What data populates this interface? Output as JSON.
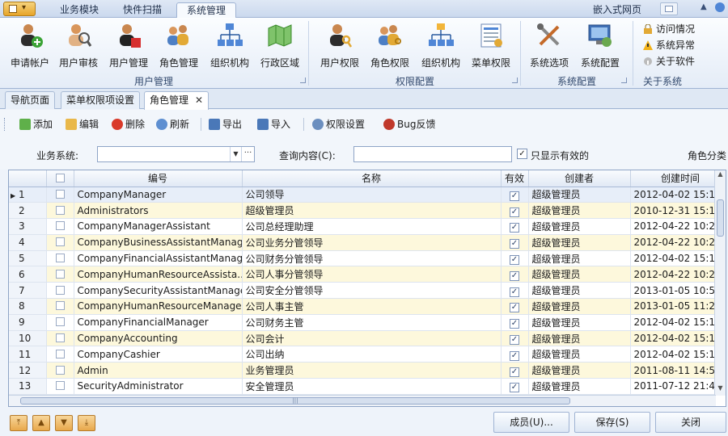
{
  "app": {
    "menu_tabs": [
      "业务模块",
      "快件扫描",
      "系统管理"
    ],
    "embed_label": "嵌入式网页"
  },
  "ribbon": {
    "groups": [
      {
        "label": "用户管理",
        "buttons": [
          "申请帐户",
          "用户审核",
          "用户管理",
          "角色管理",
          "组织机构",
          "行政区域"
        ]
      },
      {
        "label": "权限配置",
        "buttons": [
          "用户权限",
          "角色权限",
          "组织机构",
          "菜单权限"
        ]
      },
      {
        "label": "系统配置",
        "buttons": [
          "系统选项",
          "系统配置"
        ]
      },
      {
        "label": "关于系统",
        "small_items": [
          "访问情况",
          "系统异常",
          "关于软件"
        ]
      }
    ]
  },
  "doc_tabs": [
    "导航页面",
    "菜单权限项设置",
    "角色管理"
  ],
  "toolbar": {
    "items": [
      "添加",
      "编辑",
      "删除",
      "刷新",
      "导出",
      "导入",
      "权限设置",
      "Bug反馈"
    ]
  },
  "search": {
    "business_label": "业务系统:",
    "business_value": "",
    "query_label": "查询内容(C):",
    "query_value": "",
    "only_valid_label": "只显示有效的",
    "only_valid_checked": true,
    "category_label": "角色分类"
  },
  "grid": {
    "columns": [
      "",
      "",
      "编号",
      "名称",
      "有效",
      "创建者",
      "创建时间"
    ],
    "rows": [
      {
        "n": "1",
        "code": "CompanyManager",
        "name": "公司领导",
        "valid": true,
        "creator": "超级管理员",
        "time": "2012-04-02 15:1"
      },
      {
        "n": "2",
        "code": "Administrators",
        "name": "超级管理员",
        "valid": true,
        "creator": "超级管理员",
        "time": "2010-12-31 15:1"
      },
      {
        "n": "3",
        "code": "CompanyManagerAssistant",
        "name": "公司总经理助理",
        "valid": true,
        "creator": "超级管理员",
        "time": "2012-04-22 10:2"
      },
      {
        "n": "4",
        "code": "CompanyBusinessAssistantManager",
        "name": "公司业务分管领导",
        "valid": true,
        "creator": "超级管理员",
        "time": "2012-04-22 10:2"
      },
      {
        "n": "5",
        "code": "CompanyFinancialAssistantManager",
        "name": "公司财务分管领导",
        "valid": true,
        "creator": "超级管理员",
        "time": "2012-04-02 15:1"
      },
      {
        "n": "6",
        "code": "CompanyHumanResourceAssista...",
        "name": "公司人事分管领导",
        "valid": true,
        "creator": "超级管理员",
        "time": "2012-04-22 10:2"
      },
      {
        "n": "7",
        "code": "CompanySecurityAssistantManager",
        "name": "公司安全分管领导",
        "valid": true,
        "creator": "超级管理员",
        "time": "2013-01-05 10:5"
      },
      {
        "n": "8",
        "code": "CompanyHumanResourceManager",
        "name": "公司人事主管",
        "valid": true,
        "creator": "超级管理员",
        "time": "2013-01-05 11:2"
      },
      {
        "n": "9",
        "code": "CompanyFinancialManager",
        "name": "公司财务主管",
        "valid": true,
        "creator": "超级管理员",
        "time": "2012-04-02 15:1"
      },
      {
        "n": "10",
        "code": "CompanyAccounting",
        "name": "公司会计",
        "valid": true,
        "creator": "超级管理员",
        "time": "2012-04-02 15:1"
      },
      {
        "n": "11",
        "code": "CompanyCashier",
        "name": "公司出纳",
        "valid": true,
        "creator": "超级管理员",
        "time": "2012-04-02 15:1"
      },
      {
        "n": "12",
        "code": "Admin",
        "name": "业务管理员",
        "valid": true,
        "creator": "超级管理员",
        "time": "2011-08-11 14:5"
      },
      {
        "n": "13",
        "code": "SecurityAdministrator",
        "name": "安全管理员",
        "valid": true,
        "creator": "超级管理员",
        "time": "2011-07-12 21:4"
      }
    ]
  },
  "bottom": {
    "members_label": "成员(U)...",
    "save_label": "保存(S)",
    "close_label": "关闭"
  },
  "colors": {
    "accent": "#9fb3d3",
    "row_highlight": "#fdf8dc"
  }
}
